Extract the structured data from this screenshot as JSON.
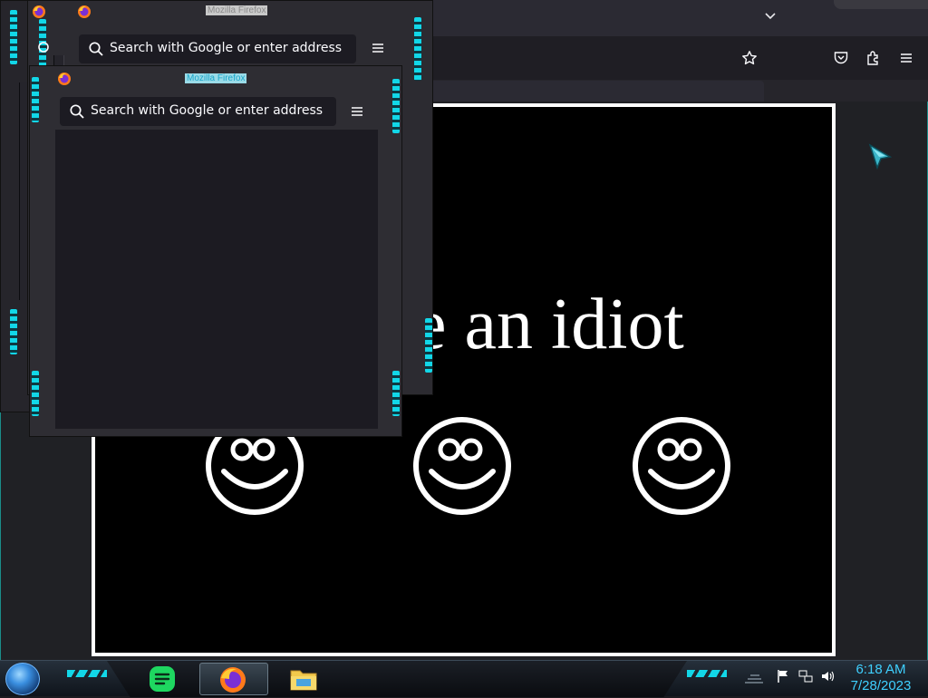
{
  "background_browser": {
    "urlbar": {
      "value": ""
    },
    "icons": [
      "chevron-down-icon",
      "star-icon",
      "pocket-icon",
      "extensions-icon",
      "hamburger-menu-icon"
    ]
  },
  "page": {
    "headline": "e an idiot"
  },
  "popups": [
    {
      "title": "Mozilla Firefox",
      "search_placeholder": "Search with Google or enter address"
    },
    {
      "title": "Mozilla Firefox",
      "search_placeholder": "Search with Google or enter address"
    }
  ],
  "taskbar": {
    "apps": [
      "spotify",
      "firefox",
      "file-explorer"
    ],
    "tray_icons": [
      "action-center-flag-icon",
      "network-icon",
      "volume-icon"
    ],
    "clock": {
      "time": "6:18 AM",
      "date": "7/28/2023"
    }
  },
  "colors": {
    "accent_cyan": "#12d7e8",
    "clock_blue": "#3fd0ff",
    "toolbar": "#2b2a33",
    "page_bg": "#000000"
  }
}
